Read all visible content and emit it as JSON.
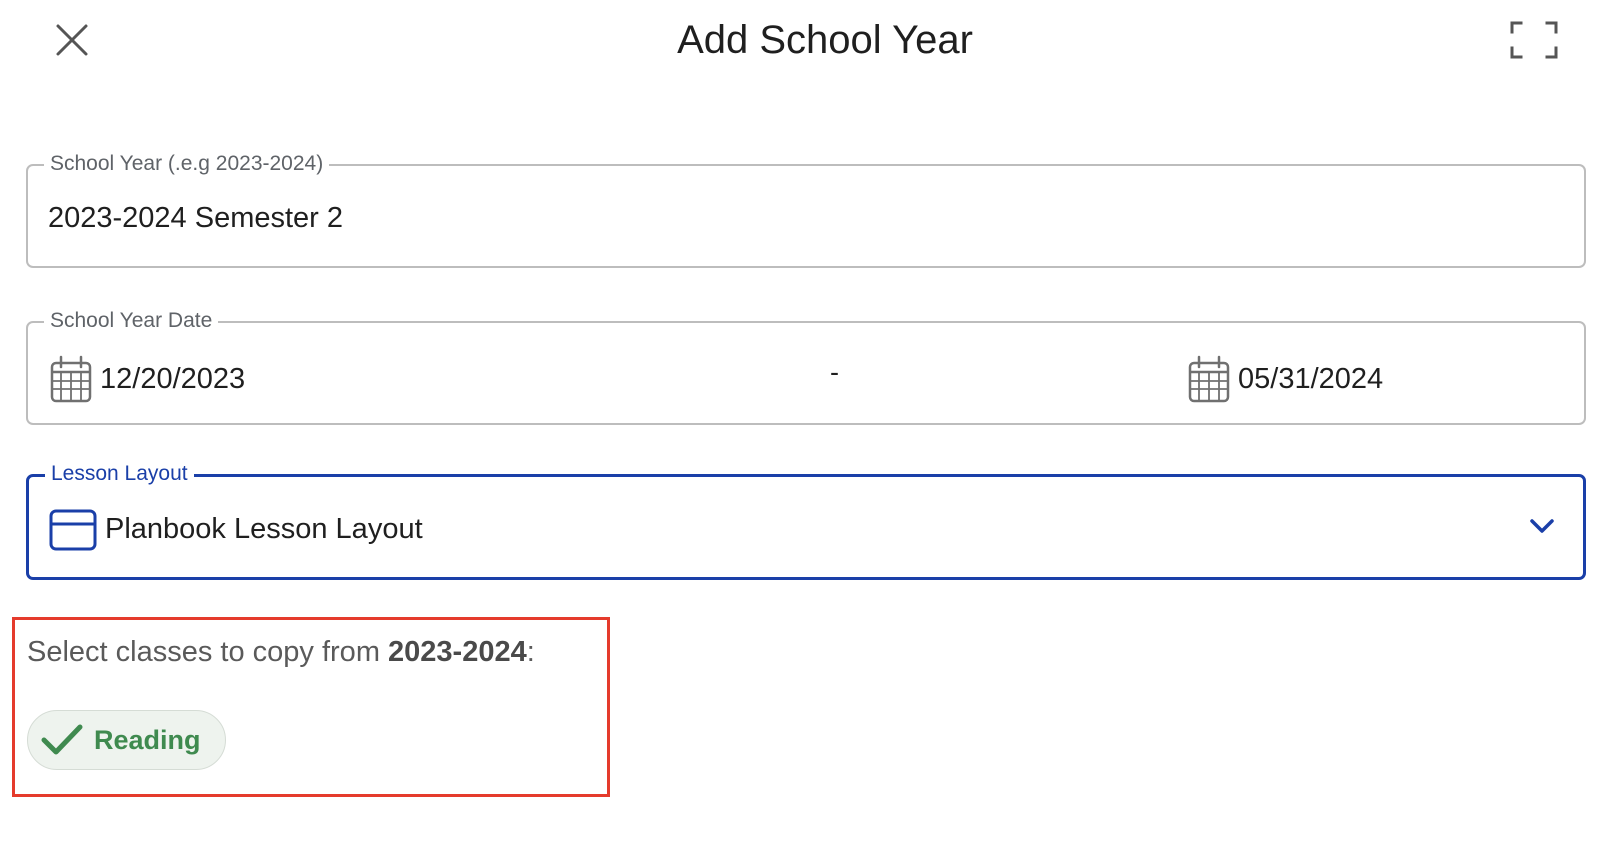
{
  "dialog": {
    "title": "Add School Year",
    "close_icon": "close-icon",
    "expand_icon": "fullscreen-icon"
  },
  "school_year_field": {
    "label": "School Year (.e.g 2023-2024)",
    "value": "2023-2024 Semester 2"
  },
  "date_field": {
    "label": "School Year Date",
    "start_date": "12/20/2023",
    "separator": "-",
    "end_date": "05/31/2024",
    "icon": "calendar-icon"
  },
  "layout_field": {
    "label": "Lesson Layout",
    "value": "Planbook Lesson Layout",
    "icon": "layout-icon",
    "dropdown_icon": "chevron-down-icon",
    "accent_color": "#1a3fa8"
  },
  "copy_section": {
    "prefix": "Select classes to copy from ",
    "source_year": "2023-2024",
    "suffix": ":",
    "highlight_color": "#e53b2c",
    "classes": [
      {
        "label": "Reading",
        "selected": true,
        "color": "#3f8a4f"
      }
    ]
  }
}
